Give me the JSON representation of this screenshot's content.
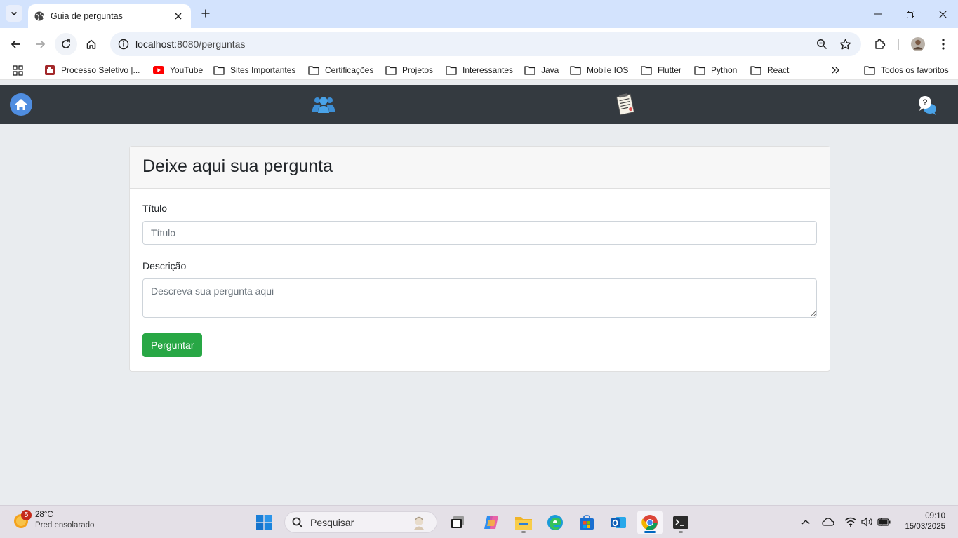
{
  "browser": {
    "tab_title": "Guia de perguntas",
    "url_host": "localhost",
    "url_path": ":8080/perguntas",
    "bookmarks": [
      {
        "label": "Processo Seletivo |..."
      },
      {
        "label": "YouTube"
      },
      {
        "label": "Sites Importantes"
      },
      {
        "label": "Certificações"
      },
      {
        "label": "Projetos"
      },
      {
        "label": "Interessantes"
      },
      {
        "label": "Java"
      },
      {
        "label": "Mobile IOS"
      },
      {
        "label": "Flutter"
      },
      {
        "label": "Python"
      },
      {
        "label": "React"
      }
    ],
    "all_bookmarks": "Todos os favoritos"
  },
  "navbar": {
    "icons": [
      "home-icon",
      "users-icon",
      "form-icon",
      "question-chat-icon"
    ]
  },
  "form": {
    "heading": "Deixe aqui sua pergunta",
    "title_label": "Título",
    "title_placeholder": "Título",
    "description_label": "Descrição",
    "description_placeholder": "Descreva sua pergunta aqui",
    "submit_label": "Perguntar"
  },
  "taskbar": {
    "weather_badge": "5",
    "weather_temp": "28°C",
    "weather_condition": "Pred ensolarado",
    "search_placeholder": "Pesquisar",
    "time": "09:10",
    "date": "15/03/2025"
  },
  "colors": {
    "navbar_bg": "#343a40",
    "page_bg": "#e9ecef",
    "success": "#28a745",
    "brand_blue": "#3d7ad6"
  }
}
